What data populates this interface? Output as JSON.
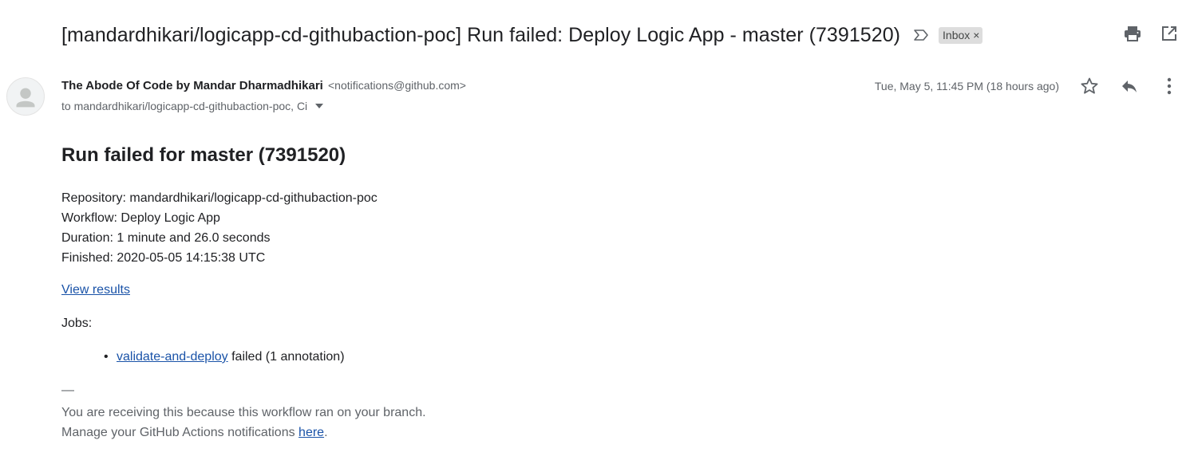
{
  "email": {
    "subject": "[mandardhikari/logicapp-cd-githubaction-poc] Run failed: Deploy Logic App - master (7391520)",
    "label": "Inbox",
    "label_remove": "×",
    "sender": {
      "name": "The Abode Of Code by Mandar Dharmadhikari",
      "email": "<notifications@github.com>"
    },
    "recipients": "to mandardhikari/logicapp-cd-githubaction-poc, Ci",
    "date": "Tue, May 5, 11:45 PM (18 hours ago)"
  },
  "body": {
    "heading": "Run failed for master (7391520)",
    "details": [
      "Repository: mandardhikari/logicapp-cd-githubaction-poc",
      "Workflow: Deploy Logic App",
      "Duration: 1 minute and 26.0 seconds",
      "Finished: 2020-05-05 14:15:38 UTC"
    ],
    "view_results": "View results",
    "jobs_label": "Jobs:",
    "jobs": [
      {
        "bullet": "•",
        "name": "validate-and-deploy",
        "status": " failed (1 annotation)"
      }
    ],
    "divider": "—",
    "footer": {
      "line1": "You are receiving this because this workflow ran on your branch.",
      "line2_prefix": "Manage your GitHub Actions notifications ",
      "line2_link": "here",
      "line2_suffix": "."
    }
  },
  "colors": {
    "link": "#1a53a8",
    "text": "#202124",
    "secondary": "#5f6368",
    "chip_bg": "#dddddd"
  },
  "icons": {
    "important": "important-marker-icon",
    "print": "print-icon",
    "open_new_window": "open-in-new-window-icon",
    "star": "star-icon",
    "reply": "reply-icon",
    "more": "more-vert-icon",
    "avatar": "default-avatar-icon",
    "caret": "caret-down-icon"
  }
}
